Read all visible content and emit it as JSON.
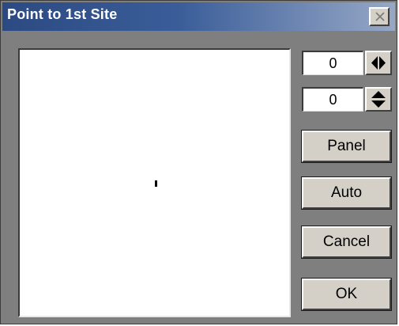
{
  "window": {
    "title": "Point to 1st Site"
  },
  "controls": {
    "horizontal_value": "0",
    "vertical_value": "0"
  },
  "buttons": {
    "panel": "Panel",
    "auto": "Auto",
    "cancel": "Cancel",
    "ok": "OK"
  },
  "icons": {
    "close": "close-icon",
    "horizontal": "left-right-arrows-icon",
    "vertical": "up-down-arrows-icon"
  },
  "colors": {
    "title_bar_start": "#2c4a82",
    "title_bar_end": "#97a8c6",
    "window_bg": "#7f7f7f",
    "button_face": "#d4d0c8"
  }
}
